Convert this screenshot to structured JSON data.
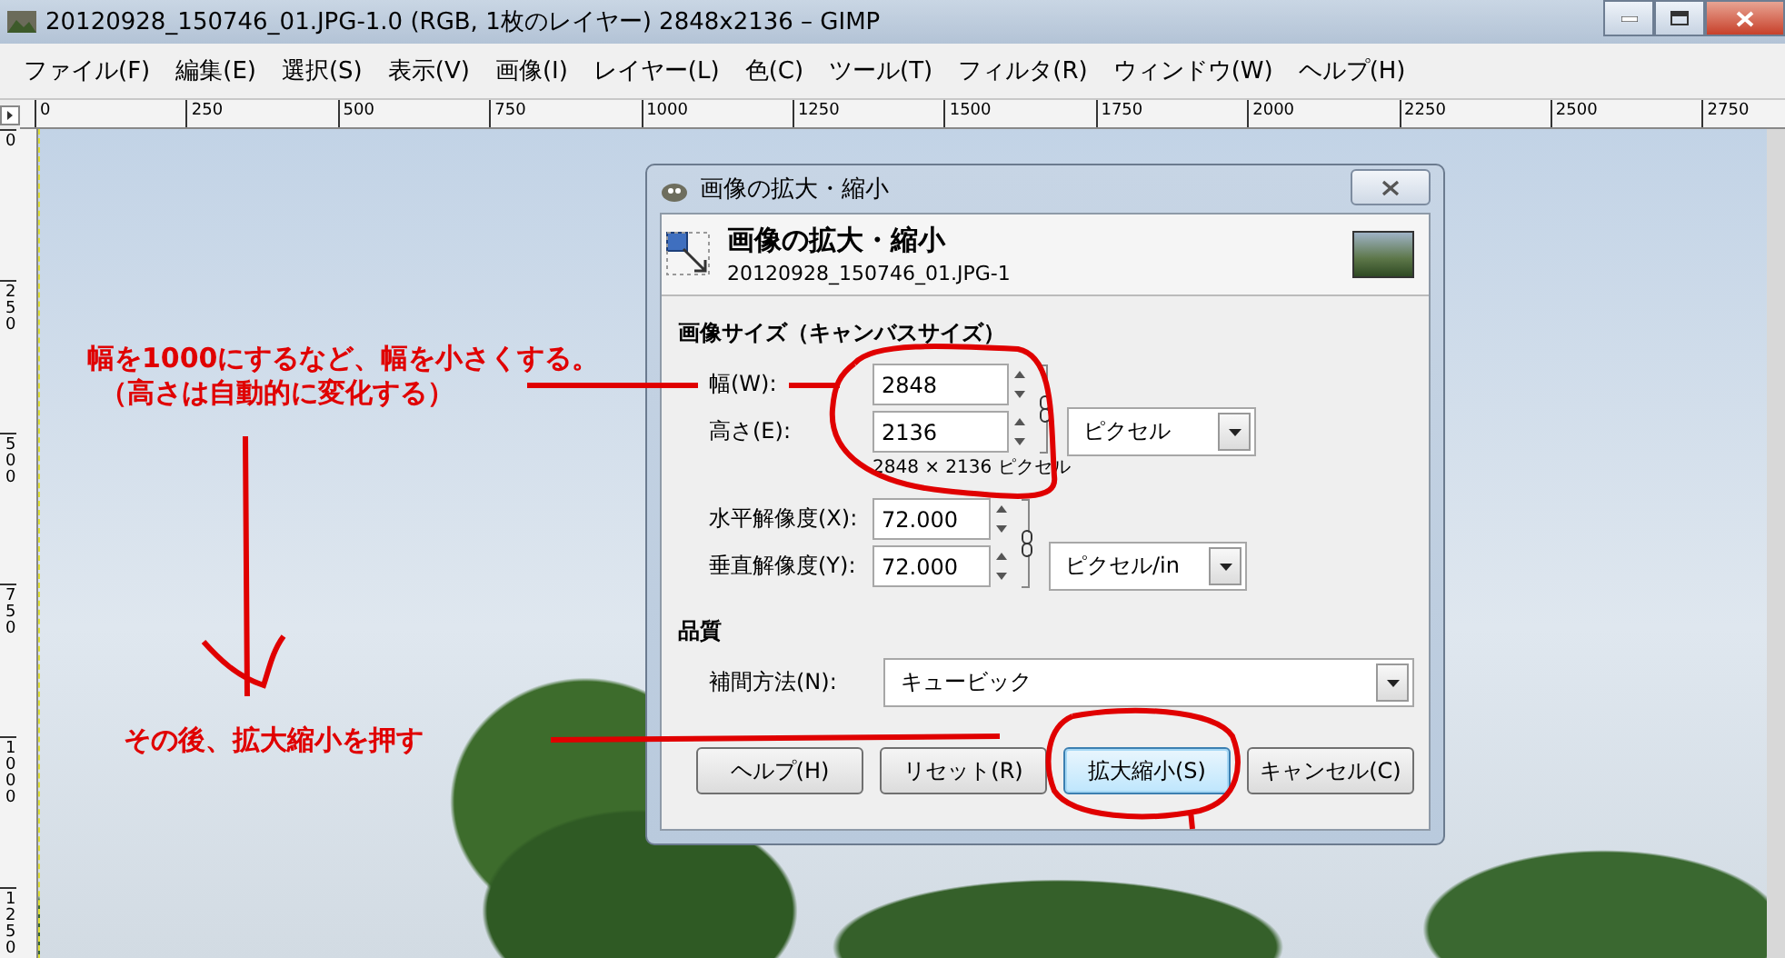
{
  "window": {
    "title": "20120928_150746_01.JPG-1.0 (RGB, 1枚のレイヤー) 2848x2136 – GIMP"
  },
  "menu": [
    {
      "label": "ファイル(F)"
    },
    {
      "label": "編集(E)"
    },
    {
      "label": "選択(S)"
    },
    {
      "label": "表示(V)"
    },
    {
      "label": "画像(I)"
    },
    {
      "label": "レイヤー(L)"
    },
    {
      "label": "色(C)"
    },
    {
      "label": "ツール(T)"
    },
    {
      "label": "フィルタ(R)"
    },
    {
      "label": "ウィンドウ(W)"
    },
    {
      "label": "ヘルプ(H)"
    }
  ],
  "rulers": {
    "horizontal": [
      "0",
      "250",
      "500",
      "750",
      "1000",
      "1250",
      "1500",
      "1750",
      "2000",
      "2250",
      "2500",
      "2750"
    ],
    "vertical": [
      "0",
      "250",
      "500",
      "750",
      "1000",
      "1250"
    ]
  },
  "annotations": [
    {
      "text": "幅を1000にするなど、幅を小さくする。"
    },
    {
      "text": "（高さは自動的に変化する）"
    },
    {
      "text": "その後、拡大縮小を押す"
    }
  ],
  "dialog": {
    "title": "画像の拡大・縮小",
    "header": {
      "title": "画像の拡大・縮小",
      "subtitle": "20120928_150746_01.JPG-1"
    },
    "size_section": {
      "heading": "画像サイズ（キャンバスサイズ）",
      "width": {
        "label": "幅(W):",
        "value": "2848"
      },
      "height": {
        "label": "高さ(E):",
        "value": "2136"
      },
      "unit": "ピクセル",
      "note": "2848 × 2136 ピクセル"
    },
    "resolution": {
      "x": {
        "label": "水平解像度(X):",
        "value": "72.000"
      },
      "y": {
        "label": "垂直解像度(Y):",
        "value": "72.000"
      },
      "unit": "ピクセル/in"
    },
    "quality": {
      "heading": "品質",
      "interpolation": {
        "label": "補間方法(N):",
        "value": "キュービック"
      }
    },
    "buttons": [
      {
        "label": "ヘルプ(H)",
        "default": false
      },
      {
        "label": "リセット(R)",
        "default": false
      },
      {
        "label": "拡大縮小(S)",
        "default": true
      },
      {
        "label": "キャンセル(C)",
        "default": false
      }
    ]
  }
}
